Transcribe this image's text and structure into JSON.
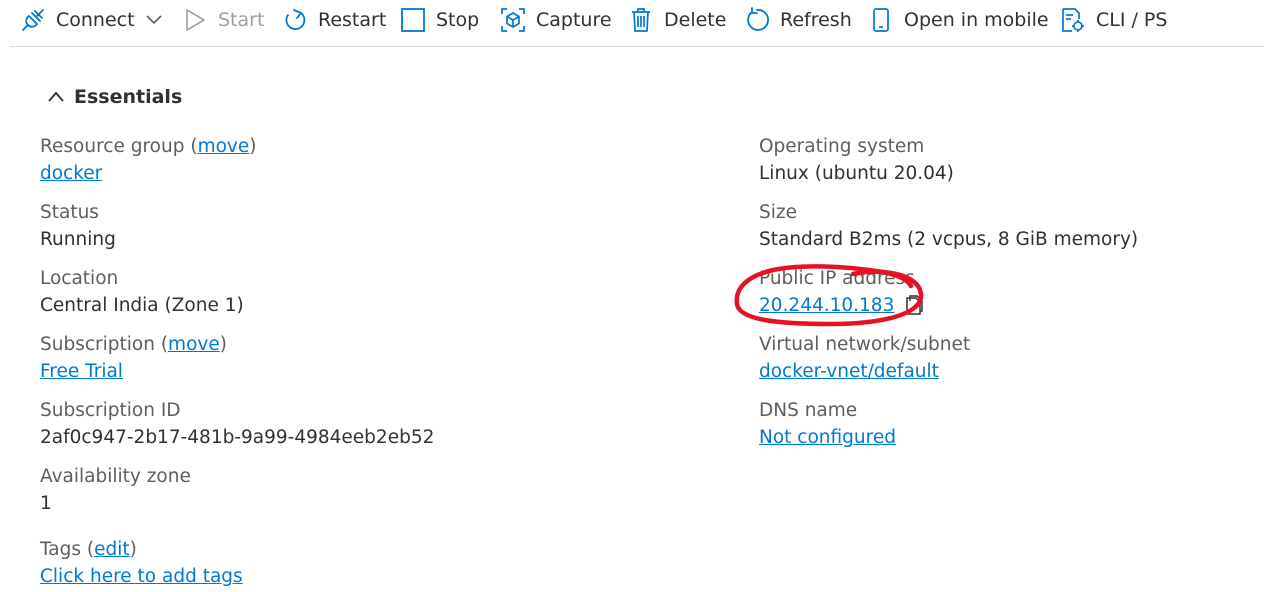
{
  "toolbar": {
    "items": [
      {
        "label": "Connect",
        "icon": "plug-icon",
        "has_dropdown": true,
        "enabled": true
      },
      {
        "label": "Start",
        "icon": "play-icon",
        "enabled": false
      },
      {
        "label": "Restart",
        "icon": "restart-icon",
        "enabled": true
      },
      {
        "label": "Stop",
        "icon": "stop-icon",
        "enabled": true
      },
      {
        "label": "Capture",
        "icon": "capture-icon",
        "enabled": true
      },
      {
        "label": "Delete",
        "icon": "trash-icon",
        "enabled": true
      },
      {
        "label": "Refresh",
        "icon": "refresh-icon",
        "enabled": true
      },
      {
        "label": "Open in mobile",
        "icon": "mobile-icon",
        "enabled": true
      },
      {
        "label": "CLI / PS",
        "icon": "cli-icon",
        "enabled": true
      }
    ]
  },
  "essentials": {
    "title": "Essentials",
    "left": {
      "resource_group": {
        "label": "Resource group (",
        "move": "move",
        "close": ")",
        "value": "docker"
      },
      "status": {
        "label": "Status",
        "value": "Running"
      },
      "location": {
        "label": "Location",
        "value": "Central India (Zone 1)"
      },
      "subscription": {
        "label": "Subscription (",
        "move": "move",
        "close": ")",
        "value": "Free Trial"
      },
      "subscription_id": {
        "label": "Subscription ID",
        "value": "2af0c947-2b17-481b-9a99-4984eeb2eb52"
      },
      "availability_zone": {
        "label": "Availability zone",
        "value": "1"
      },
      "tags": {
        "label": "Tags (",
        "edit": "edit",
        "close": ")",
        "value": "Click here to add tags"
      }
    },
    "right": {
      "os": {
        "label": "Operating system",
        "value": "Linux (ubuntu 20.04)"
      },
      "size": {
        "label": "Size",
        "value": "Standard B2ms (2 vcpus, 8 GiB memory)"
      },
      "public_ip": {
        "label": "Public IP address",
        "value": "20.244.10.183"
      },
      "vnet": {
        "label": "Virtual network/subnet",
        "value": "docker-vnet/default"
      },
      "dns": {
        "label": "DNS name",
        "value": "Not configured"
      }
    }
  },
  "colors": {
    "link": "#0078d4",
    "icon": "#0078d4",
    "annotation": "#e81123"
  }
}
